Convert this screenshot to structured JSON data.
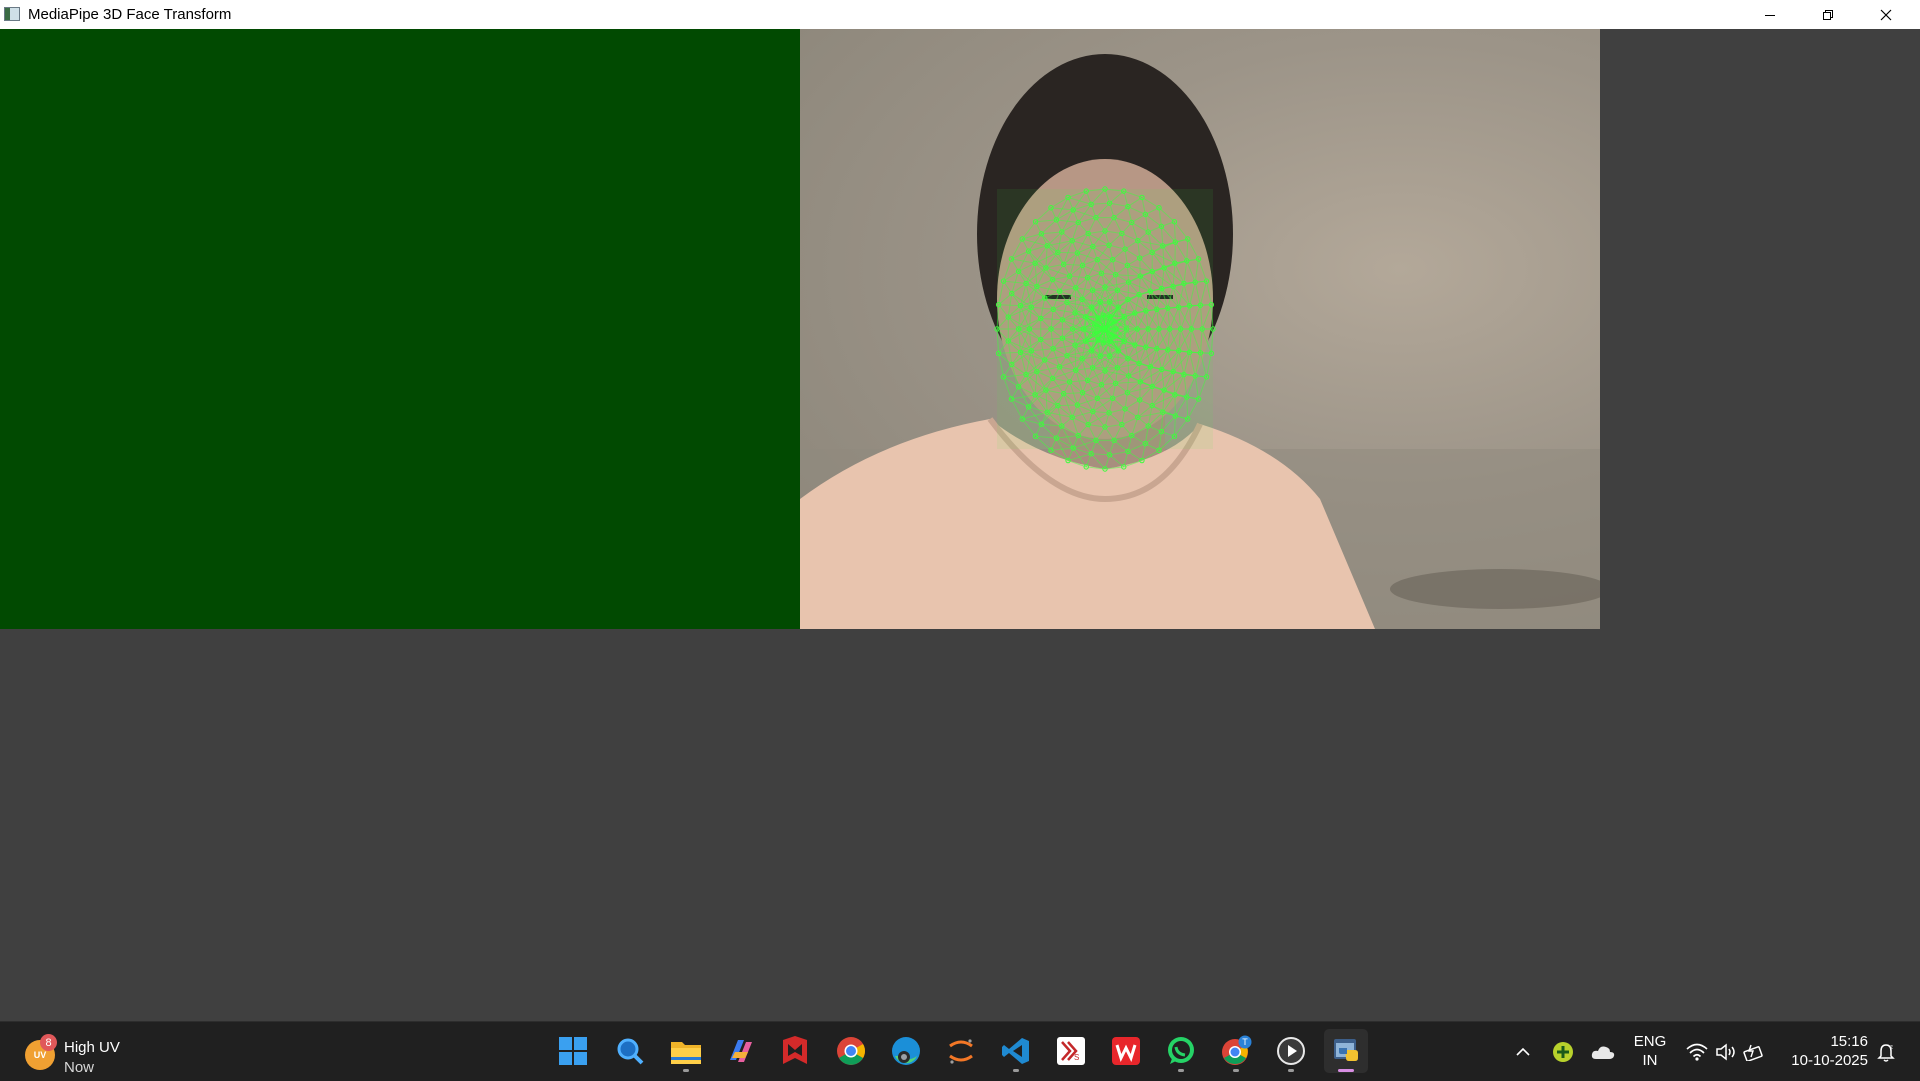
{
  "window": {
    "title": "MediaPipe 3D Face Transform"
  },
  "colors": {
    "left_panel": "#014a01",
    "mesh": "#3cff3c",
    "client_bg": "#404040",
    "taskbar_bg": "#202020"
  },
  "weather": {
    "badge": "8",
    "icon_text": "UV",
    "title": "High UV",
    "subtitle": "Now"
  },
  "taskbar": {
    "apps": [
      {
        "name": "start-icon"
      },
      {
        "name": "search-icon"
      },
      {
        "name": "file-explorer-icon"
      },
      {
        "name": "copilot-icon"
      },
      {
        "name": "mcafee-icon"
      },
      {
        "name": "chrome-icon"
      },
      {
        "name": "edge-icon"
      },
      {
        "name": "jupyter-icon"
      },
      {
        "name": "vscode-icon"
      },
      {
        "name": "kicad-icon"
      },
      {
        "name": "wps-office-icon"
      },
      {
        "name": "whatsapp-icon"
      },
      {
        "name": "chrome-profile-icon"
      },
      {
        "name": "media-player-icon"
      },
      {
        "name": "python-icon"
      }
    ],
    "chrome_profile_badge": "T"
  },
  "tray": {
    "lang_line1": "ENG",
    "lang_line2": "IN",
    "time": "15:16",
    "date": "10-10-2025"
  }
}
